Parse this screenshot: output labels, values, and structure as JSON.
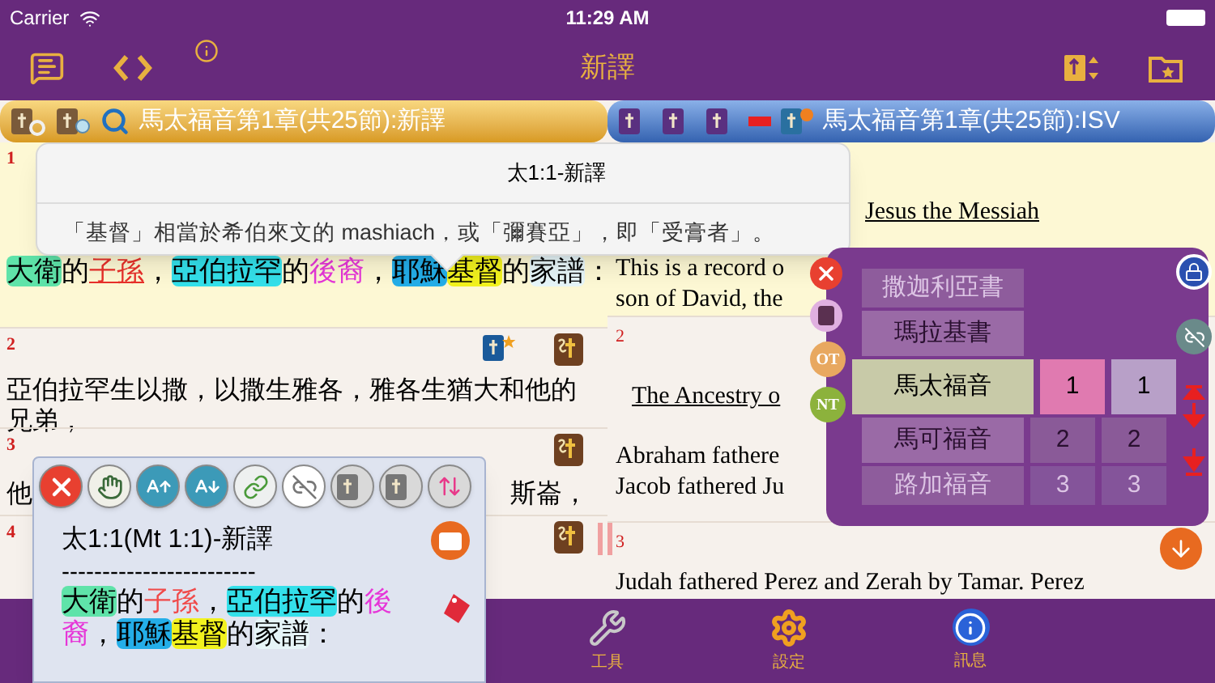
{
  "status_bar": {
    "carrier": "Carrier",
    "time": "11:29 AM"
  },
  "nav_bar": {
    "title": "新譯"
  },
  "left_pane": {
    "header": "馬太福音第1章(共25節):新譯",
    "verses": [
      {
        "number": "1",
        "kind": "segments",
        "selected": true,
        "segments": [
          {
            "text": "大衛",
            "kind": "highlight",
            "color": "#5fe3a9"
          },
          {
            "text": "的"
          },
          {
            "text": "子孫",
            "kind": "ink",
            "color": "#e8302a",
            "underline": true
          },
          {
            "text": "，"
          },
          {
            "text": "亞伯拉罕",
            "kind": "highlight",
            "color": "#34e0ea"
          },
          {
            "text": "的"
          },
          {
            "text": "後裔",
            "kind": "ink",
            "color": "#e636d8"
          },
          {
            "text": "，"
          },
          {
            "text": "耶穌",
            "kind": "highlight",
            "color": "#24aee8"
          },
          {
            "text": "基督",
            "kind": "highlight",
            "color": "#f2f21e"
          },
          {
            "text": "的"
          },
          {
            "text": "家譜",
            "kind": "highlight",
            "color": "#e6f5f8"
          },
          {
            "text": "："
          }
        ]
      },
      {
        "number": "2",
        "kind": "text",
        "selected": false,
        "text": "亞伯拉罕生以撒，以撒生雅各，雅各生猶大和他的兄弟，"
      },
      {
        "number": "3",
        "kind": "fragments",
        "selected": false,
        "fragments": [
          "他",
          "斯崙，"
        ]
      },
      {
        "number": "4",
        "kind": "number_only",
        "selected": false
      }
    ]
  },
  "right_pane": {
    "header": "馬太福音第1章(共25節):ISV",
    "verses": [
      {
        "selected": true,
        "heading": "Jesus the Messiah",
        "lines": [
          "This is a record o",
          "son of David, the"
        ]
      },
      {
        "number": "2",
        "selected": false,
        "heading": "The Ancestry o",
        "lines": [
          "Abraham fathere",
          "Jacob fathered Ju"
        ]
      },
      {
        "number": "3",
        "selected": false,
        "lines": [
          "Judah fathered Perez and Zerah by Tamar. Perez"
        ]
      }
    ]
  },
  "popover": {
    "title": "太1:1-新譯",
    "body": "「基督」相當於希伯來文的 mashiach，或「彌賽亞」，即「受膏者」。"
  },
  "floating_panel": {
    "title": "太1:1(Mt 1:1)-新譯",
    "separator": "------------------------",
    "segments": [
      {
        "text": "大衛",
        "kind": "highlight",
        "color": "#5fe3a9"
      },
      {
        "text": "的"
      },
      {
        "text": "子孫",
        "kind": "ink",
        "color": "#f04a4a"
      },
      {
        "text": "，"
      },
      {
        "text": "亞伯拉罕",
        "kind": "highlight",
        "color": "#34e0ea"
      },
      {
        "text": "的"
      },
      {
        "text": "後裔",
        "kind": "ink",
        "color": "#e636d8"
      },
      {
        "text": "，"
      },
      {
        "text": "耶穌",
        "kind": "highlight",
        "color": "#24aee8"
      },
      {
        "text": "基督",
        "kind": "highlight",
        "color": "#f2f21e"
      },
      {
        "text": "的"
      },
      {
        "text": "家譜",
        "kind": "highlight",
        "color": "#e6f5f8"
      },
      {
        "text": "："
      }
    ]
  },
  "picker": {
    "testaments": [
      {
        "label": "OT",
        "color": "#e8a860"
      },
      {
        "label": "NT",
        "color": "#8cb23c"
      }
    ],
    "rows": [
      {
        "book": "撒迦利亞書",
        "selected": false
      },
      {
        "book": "瑪拉基書",
        "selected": false
      },
      {
        "book": "馬太福音",
        "chapter": "1",
        "verse": "1",
        "selected": true
      },
      {
        "book": "馬可福音",
        "chapter": "2",
        "verse": "2",
        "selected": false
      },
      {
        "book": "路加福音",
        "chapter": "3",
        "verse": "3",
        "selected": false
      }
    ]
  },
  "tab_bar": {
    "items": [
      {
        "label": "工具",
        "kind": "tools"
      },
      {
        "label": "設定",
        "kind": "settings"
      },
      {
        "label": "訊息",
        "kind": "info"
      }
    ]
  }
}
